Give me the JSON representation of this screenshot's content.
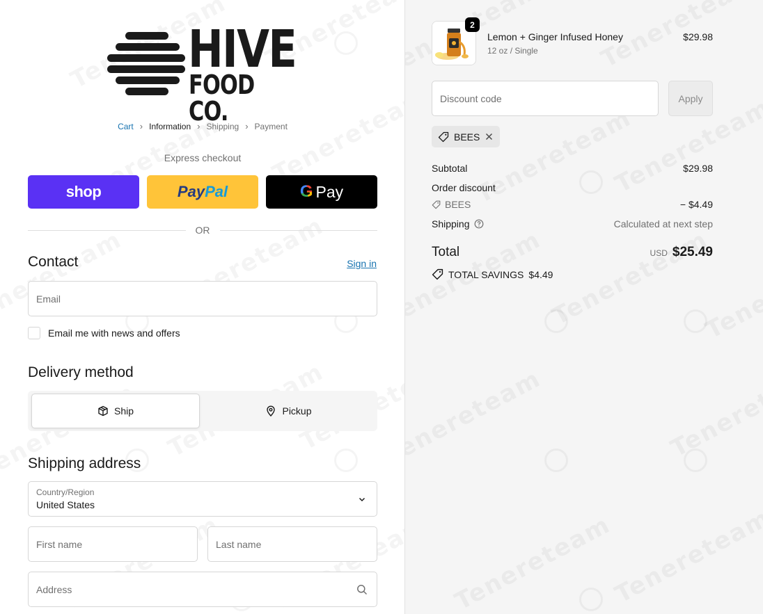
{
  "brand": {
    "line1": "HIVE",
    "line2": "FOOD CO."
  },
  "breadcrumb": [
    "Cart",
    "Information",
    "Shipping",
    "Payment"
  ],
  "express": {
    "label": "Express checkout",
    "shop_label": "shop",
    "paypal_part1": "Pay",
    "paypal_part2": "Pal",
    "gpay_g": "G",
    "gpay_label": "Pay",
    "or": "OR"
  },
  "contact": {
    "heading": "Contact",
    "signin": "Sign in",
    "email_placeholder": "Email",
    "newsletter": "Email me with news and offers"
  },
  "delivery": {
    "heading": "Delivery method",
    "ship": "Ship",
    "pickup": "Pickup"
  },
  "shipping": {
    "heading": "Shipping address",
    "country_label": "Country/Region",
    "country_value": "United States",
    "first_name": "First name",
    "last_name": "Last name",
    "address": "Address"
  },
  "cart": {
    "quantity": "2",
    "product_name": "Lemon + Ginger Infused Honey",
    "variant": "12 oz / Single",
    "price": "$29.98"
  },
  "discount": {
    "placeholder": "Discount code",
    "apply": "Apply",
    "code": "BEES"
  },
  "summary": {
    "subtotal_label": "Subtotal",
    "subtotal_value": "$29.98",
    "order_discount_label": "Order discount",
    "discount_code": "BEES",
    "discount_value": "− $4.49",
    "shipping_label": "Shipping",
    "shipping_value": "Calculated at next step",
    "total_label": "Total",
    "currency": "USD",
    "total_value": "$25.49",
    "savings_label": "TOTAL SAVINGS",
    "savings_value": "$4.49"
  },
  "watermark": "Tenereteam",
  "colors": {
    "shop": "#5a31f4",
    "paypal": "#ffc439",
    "link": "#1773b0"
  }
}
